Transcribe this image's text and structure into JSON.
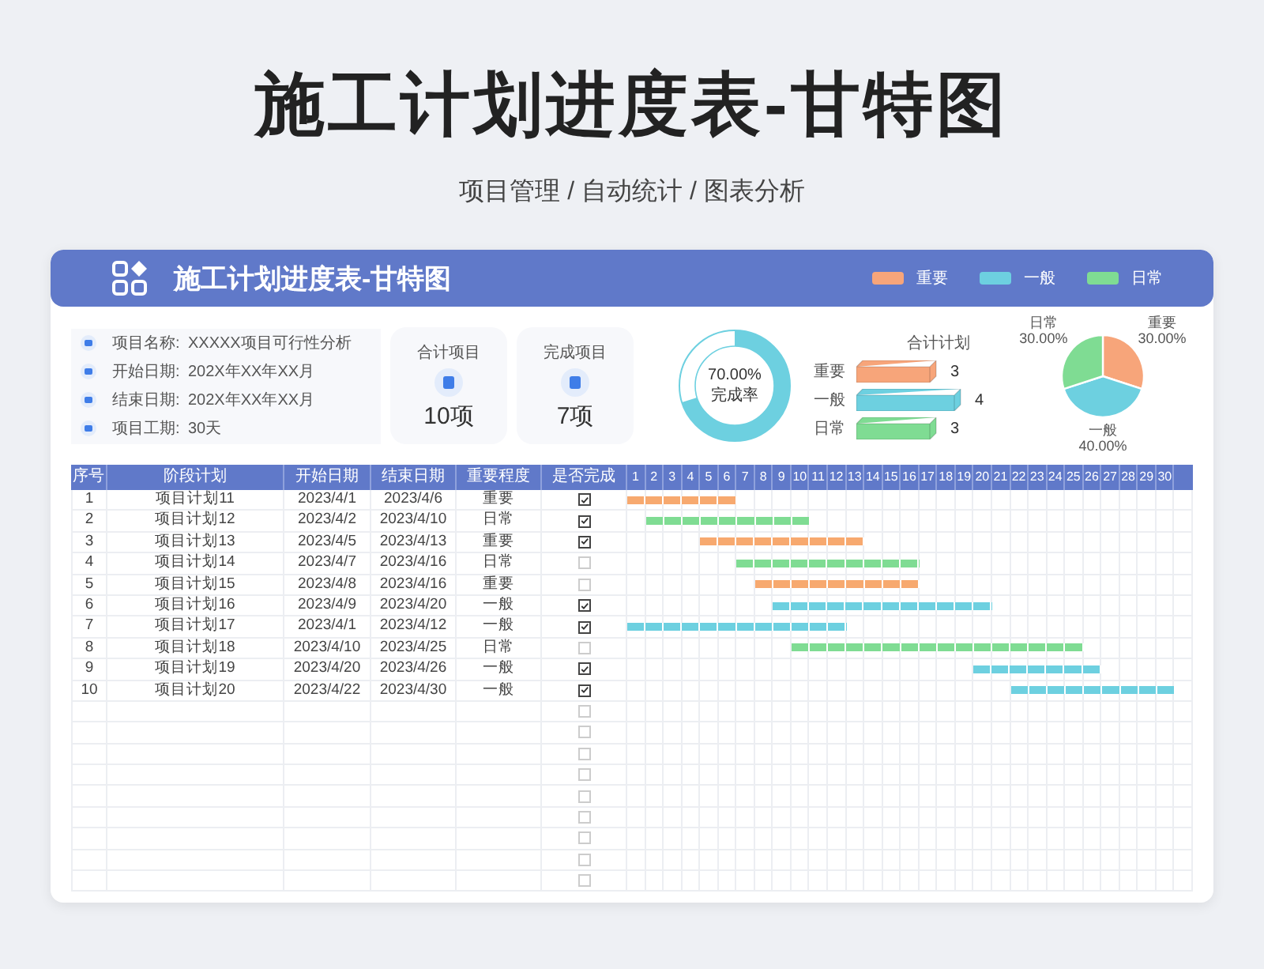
{
  "title": "施工计划进度表-甘特图",
  "subtitle": "项目管理 / 自动统计 / 图表分析",
  "card": {
    "title": "施工计划进度表-甘特图",
    "legend": [
      {
        "label": "重要",
        "color": "#f7a57a"
      },
      {
        "label": "一般",
        "color": "#6dd0e0"
      },
      {
        "label": "日常",
        "color": "#7fdc93"
      }
    ]
  },
  "info": [
    {
      "label": "项目名称:",
      "value": "XXXXX项目可行性分析"
    },
    {
      "label": "开始日期:",
      "value": "202X年XX年XX月"
    },
    {
      "label": "结束日期:",
      "value": "202X年XX年XX月"
    },
    {
      "label": "项目工期:",
      "value": "30天"
    }
  ],
  "stats": [
    {
      "label": "合计项目",
      "value": "10项"
    },
    {
      "label": "完成项目",
      "value": "7项"
    }
  ],
  "completion": {
    "reading": "70.00%",
    "caption": "完成率",
    "level": 0.7
  },
  "plan_chart": {
    "title": "合计计划",
    "bars": [
      {
        "label": "重要",
        "value": "3",
        "level": 0.75
      },
      {
        "label": "一般",
        "value": "4",
        "level": 1
      },
      {
        "label": "日常",
        "value": "3",
        "level": 0.75
      }
    ]
  },
  "share_chart": {
    "chart_data": {
      "type": "pie",
      "categories": [
        "重要",
        "一般",
        "日常"
      ],
      "values": [
        30,
        40,
        30
      ],
      "value_labels": [
        "30.00%",
        "40.00%",
        "30.00%"
      ]
    }
  },
  "table": {
    "columns": [
      "序号",
      "阶段计划",
      "开始日期",
      "结束日期",
      "重要程度",
      "是否完成"
    ],
    "days": [
      "1",
      "2",
      "3",
      "4",
      "5",
      "6",
      "7",
      "8",
      "9",
      "10",
      "11",
      "12",
      "13",
      "14",
      "15",
      "16",
      "17",
      "18",
      "19",
      "20",
      "21",
      "22",
      "23",
      "24",
      "25",
      "26",
      "27",
      "28",
      "29",
      "30"
    ],
    "rows": [
      {
        "no": "1",
        "name": "项目计划11",
        "start": "2023/4/1",
        "end": "2023/4/6",
        "level": "重要",
        "done": true,
        "color": "#f7a96f"
      },
      {
        "no": "2",
        "name": "项目计划12",
        "start": "2023/4/2",
        "end": "2023/4/10",
        "level": "日常",
        "done": true,
        "color": "#7fdc93"
      },
      {
        "no": "3",
        "name": "项目计划13",
        "start": "2023/4/5",
        "end": "2023/4/13",
        "level": "重要",
        "done": true,
        "color": "#f7a96f"
      },
      {
        "no": "4",
        "name": "项目计划14",
        "start": "2023/4/7",
        "end": "2023/4/16",
        "level": "日常",
        "done": false,
        "color": "#7fdc93"
      },
      {
        "no": "5",
        "name": "项目计划15",
        "start": "2023/4/8",
        "end": "2023/4/16",
        "level": "重要",
        "done": false,
        "color": "#f7a96f"
      },
      {
        "no": "6",
        "name": "项目计划16",
        "start": "2023/4/9",
        "end": "2023/4/20",
        "level": "一般",
        "done": true,
        "color": "#6dd0e0"
      },
      {
        "no": "7",
        "name": "项目计划17",
        "start": "2023/4/1",
        "end": "2023/4/12",
        "level": "一般",
        "done": true,
        "color": "#6dd0e0"
      },
      {
        "no": "8",
        "name": "项目计划18",
        "start": "2023/4/10",
        "end": "2023/4/25",
        "level": "日常",
        "done": false,
        "color": "#7fdc93"
      },
      {
        "no": "9",
        "name": "项目计划19",
        "start": "2023/4/20",
        "end": "2023/4/26",
        "level": "一般",
        "done": true,
        "color": "#6dd0e0"
      },
      {
        "no": "10",
        "name": "项目计划20",
        "start": "2023/4/22",
        "end": "2023/4/30",
        "level": "一般",
        "done": true,
        "color": "#6dd0e0"
      },
      {
        "done": false
      },
      {
        "done": false
      },
      {
        "done": false
      },
      {
        "done": false
      },
      {
        "done": false
      },
      {
        "done": false
      },
      {
        "done": false
      },
      {
        "done": false
      },
      {
        "done": false
      }
    ]
  }
}
